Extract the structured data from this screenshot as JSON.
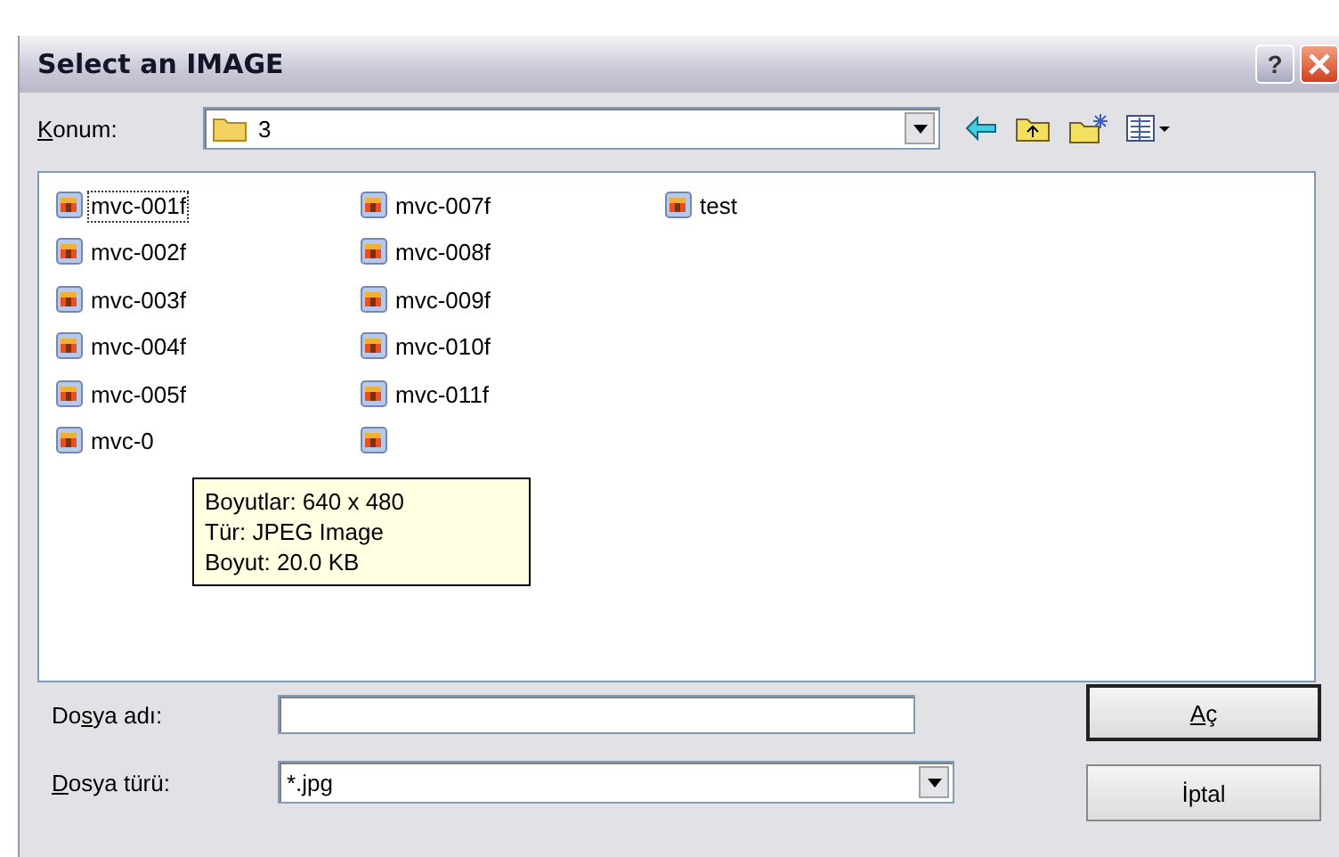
{
  "window": {
    "title": "Select an IMAGE",
    "help_label": "?"
  },
  "location": {
    "label": {
      "key": "K",
      "after": "onum:"
    },
    "value": "3"
  },
  "files": [
    {
      "kind": "file",
      "name": "mvc-001f",
      "focused": true
    },
    {
      "kind": "file",
      "name": "mvc-002f",
      "focused": false
    },
    {
      "kind": "file",
      "name": "mvc-003f",
      "focused": false
    },
    {
      "kind": "file",
      "name": "mvc-004f",
      "focused": false
    },
    {
      "kind": "file",
      "name": "mvc-005f",
      "focused": false
    },
    {
      "kind": "file",
      "name": "mvc-0",
      "focused": false
    },
    {
      "kind": "file",
      "name": "mvc-007f",
      "focused": false
    },
    {
      "kind": "file",
      "name": "mvc-008f",
      "focused": false
    },
    {
      "kind": "file",
      "name": "mvc-009f",
      "focused": false
    },
    {
      "kind": "file",
      "name": "mvc-010f",
      "focused": false
    },
    {
      "kind": "file",
      "name": "mvc-011f",
      "focused": false
    },
    {
      "kind": "covered"
    },
    {
      "kind": "file",
      "name": "test",
      "focused": false
    }
  ],
  "tooltip": [
    "Boyutlar: 640 x 480",
    "Tür: JPEG Image",
    "Boyut: 20.0 KB"
  ],
  "file_name": {
    "label": {
      "before": "Do",
      "key": "s",
      "after": "ya adı:"
    }
  },
  "file_type": {
    "label": {
      "key": "D",
      "after": "osya türü:"
    },
    "value": "*.jpg"
  },
  "buttons": [
    {
      "label": {
        "key": "A",
        "after": "ç"
      },
      "default": true
    },
    {
      "label": {
        "before": "İptal"
      },
      "default": false
    }
  ]
}
